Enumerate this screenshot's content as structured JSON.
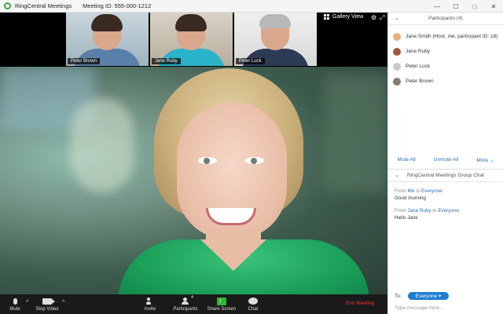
{
  "window": {
    "app_title": "RingCentral Meetings",
    "meeting_id": "Meeting ID: 555-000-1212",
    "controls": [
      "—",
      "☐",
      "□",
      "✕"
    ]
  },
  "video": {
    "gallery_view_label": "Gallery View",
    "thumbnails": [
      {
        "name": "Peter Brown"
      },
      {
        "name": "Jane Ruby"
      },
      {
        "name": "Peter Luck"
      }
    ]
  },
  "toolbar": {
    "mute": "Mute",
    "stop_video": "Stop Video",
    "invite": "Invite",
    "participants": "Participants",
    "participants_count": "4",
    "share_screen": "Share Screen",
    "chat": "Chat",
    "end_meeting": "End Meeting"
  },
  "panel": {
    "participants_title": "Participants (4)",
    "participants": [
      {
        "name": "Jane Smith (Host, me, participant ID: 18)"
      },
      {
        "name": "Jane Ruby"
      },
      {
        "name": "Peter Luck"
      },
      {
        "name": "Peter Brown"
      }
    ],
    "mute_all": "Mute All",
    "unmute_all": "Unmute All",
    "more": "More",
    "chat_title": "RingCentral Meetings Group Chat",
    "messages": [
      {
        "from_prefix": "From",
        "from": "Me",
        "to_word": "to",
        "to": "Everyone:",
        "text": "Good morning"
      },
      {
        "from_prefix": "From",
        "from": "Jane Ruby",
        "to_word": "to",
        "to": "Everyone:",
        "text": "Hello Jane"
      }
    ],
    "to_label": "To:",
    "to_value": "Everyone",
    "input_placeholder": "Type message here..."
  }
}
